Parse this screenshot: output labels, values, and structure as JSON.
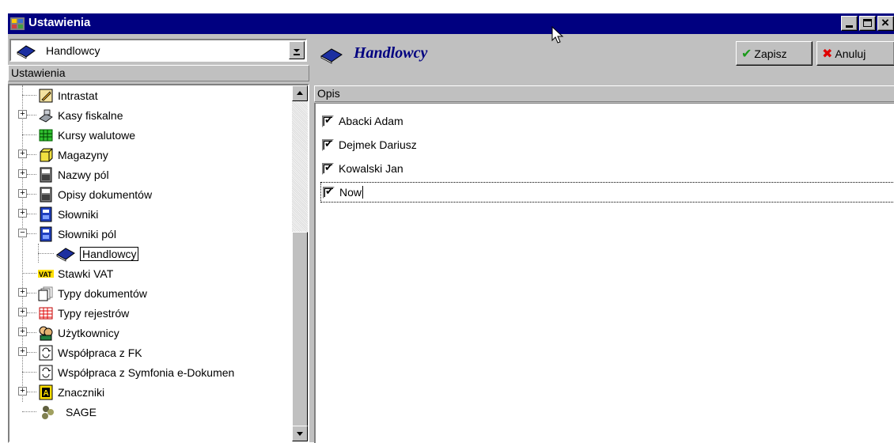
{
  "window": {
    "title": "Ustawienia"
  },
  "left_panel": {
    "combo_value": "Handlowcy",
    "header": "Ustawienia",
    "tree": [
      {
        "label": "Intrastat",
        "icon": "pencil-icon"
      },
      {
        "label": "Kasy fiskalne",
        "icon": "cash-register-icon"
      },
      {
        "label": "Kursy walutowe",
        "icon": "grid-table-icon"
      },
      {
        "label": "Magazyny",
        "icon": "cube-icon"
      },
      {
        "label": "Nazwy pól",
        "icon": "calculator-icon"
      },
      {
        "label": "Opisy dokumentów",
        "icon": "calculator-icon"
      },
      {
        "label": "Słowniki",
        "icon": "blue-form-icon"
      },
      {
        "label": "Słowniki pól",
        "icon": "blue-form-icon"
      },
      {
        "label": "Handlowcy",
        "icon": "book-icon"
      },
      {
        "label": "Stawki VAT",
        "icon": "vat-icon"
      },
      {
        "label": "Typy dokumentów",
        "icon": "documents-icon"
      },
      {
        "label": "Typy rejestrów",
        "icon": "red-grid-icon"
      },
      {
        "label": "Użytkownicy",
        "icon": "users-icon"
      },
      {
        "label": "Współpraca z FK",
        "icon": "sync-icon"
      },
      {
        "label": "Współpraca z Symfonia e-Dokumen",
        "icon": "sync-icon"
      },
      {
        "label": "Znaczniki",
        "icon": "tag-icon"
      },
      {
        "label": "SAGE",
        "icon": "sage-icon"
      }
    ]
  },
  "right_panel": {
    "title": "Handlowcy",
    "save_label": "Zapisz",
    "cancel_label": "Anuluj",
    "header": "Opis",
    "rows": [
      {
        "label": "Abacki Adam",
        "checked": true
      },
      {
        "label": "Dejmek Dariusz",
        "checked": true
      },
      {
        "label": "Kowalski Jan",
        "checked": true
      },
      {
        "label": "Now",
        "checked": true
      }
    ]
  },
  "colors": {
    "titlebar": "#000080",
    "title_accent": "#000080",
    "save_check": "#1a9a1a",
    "cancel_x": "#e00000"
  }
}
